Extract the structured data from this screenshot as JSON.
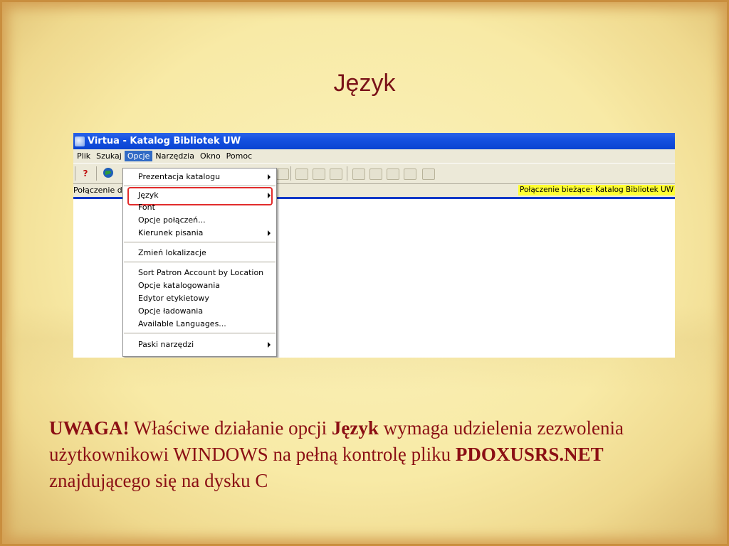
{
  "slide": {
    "title": "Język",
    "caption": {
      "warning": "UWAGA!",
      "text1": " Właściwe działanie opcji ",
      "option": "Język",
      "text2": " wymaga udzielenia zezwolenia użytkownikowi WINDOWS na pełną kontrolę pliku ",
      "file": "PDOXUSRS.NET",
      "text3": " znajdującego się na dysku C"
    }
  },
  "window": {
    "title": "Virtua - Katalog Bibliotek UW",
    "menu": [
      "Plik",
      "Szukaj",
      "Opcje",
      "Narzędzia",
      "Okno",
      "Pomoc"
    ],
    "active_menu": "Opcje",
    "toolbar_icons": [
      "help-icon",
      "globe-icon"
    ],
    "status_left": "Połączenie dom",
    "status_right": "Połączenie bieżące: Katalog Bibliotek UW"
  },
  "dropdown": {
    "items": [
      {
        "label": "Prezentacja katalogu",
        "submenu": true
      },
      {
        "label": "Język",
        "submenu": true,
        "highlighted": true
      },
      {
        "label": "Font",
        "submenu": false
      },
      {
        "label": "Opcje połączeń...",
        "submenu": false
      },
      {
        "label": "Kierunek pisania",
        "submenu": true
      },
      {
        "label": "Zmień lokalizacje",
        "submenu": false
      },
      {
        "label": "Sort Patron Account by Location",
        "submenu": false
      },
      {
        "label": "Opcje katalogowania",
        "submenu": false
      },
      {
        "label": "Edytor etykietowy",
        "submenu": false
      },
      {
        "label": "Opcje ładowania",
        "submenu": false
      },
      {
        "label": "Available Languages...",
        "submenu": false
      },
      {
        "label": "Paski narzędzi",
        "submenu": true
      }
    ]
  },
  "colors": {
    "title_text": "#7a1218",
    "caption_text": "#8b0f14",
    "highlight_border": "#e22b2b",
    "titlebar": "#1551e0",
    "status_highlight": "#ffff33"
  }
}
